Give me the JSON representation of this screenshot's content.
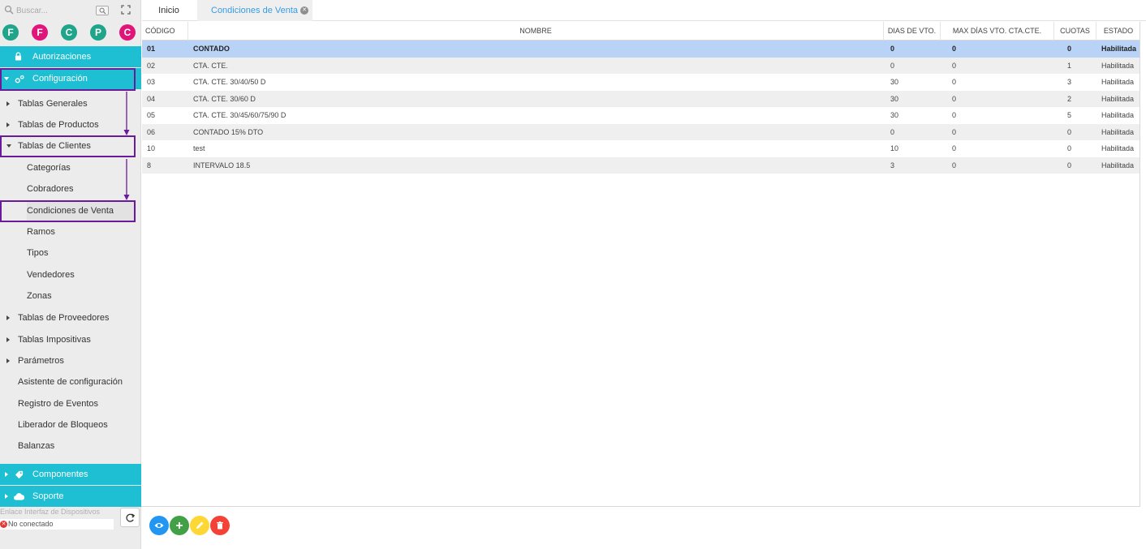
{
  "search": {
    "placeholder": "Buscar..."
  },
  "avatars": [
    {
      "letter": "F",
      "color": "#1fa58a"
    },
    {
      "letter": "F",
      "color": "#e0157a"
    },
    {
      "letter": "C",
      "color": "#1fa58a"
    },
    {
      "letter": "P",
      "color": "#1fa58a"
    },
    {
      "letter": "C",
      "color": "#e0157a"
    }
  ],
  "sidebar": {
    "autorizaciones": "Autorizaciones",
    "configuracion": "Configuración",
    "items": {
      "tablas_generales": "Tablas Generales",
      "tablas_productos": "Tablas de Productos",
      "tablas_clientes": "Tablas de Clientes",
      "categorias": "Categorías",
      "cobradores": "Cobradores",
      "condiciones": "Condiciones de Venta",
      "ramos": "Ramos",
      "tipos": "Tipos",
      "vendedores": "Vendedores",
      "zonas": "Zonas",
      "tablas_proveedores": "Tablas de Proveedores",
      "tablas_impositivas": "Tablas Impositivas",
      "parametros": "Parámetros",
      "asistente": "Asistente de configuración",
      "registro": "Registro de Eventos",
      "liberador": "Liberador de Bloqueos",
      "balanzas": "Balanzas"
    },
    "componentes": "Componentes",
    "soporte": "Soporte",
    "device_label": "Enlace Interfaz de Dispositivos",
    "device_status": "No conectado"
  },
  "tabs": {
    "home": "Inicio",
    "active": "Condiciones de Venta"
  },
  "table": {
    "headers": {
      "codigo": "CÓDIGO",
      "nombre": "NOMBRE",
      "dias": "DIAS DE VTO.",
      "max_dias": "MAX DÍAS VTO. CTA.CTE.",
      "cuotas": "CUOTAS",
      "estado": "ESTADO"
    },
    "rows": [
      {
        "codigo": "01",
        "nombre": "CONTADO",
        "dias": "0",
        "max_dias": "0",
        "cuotas": "0",
        "estado": "Habilitada"
      },
      {
        "codigo": "02",
        "nombre": "CTA. CTE.",
        "dias": "0",
        "max_dias": "0",
        "cuotas": "1",
        "estado": "Habilitada"
      },
      {
        "codigo": "03",
        "nombre": "CTA. CTE. 30/40/50 D",
        "dias": "30",
        "max_dias": "0",
        "cuotas": "3",
        "estado": "Habilitada"
      },
      {
        "codigo": "04",
        "nombre": "CTA. CTE. 30/60 D",
        "dias": "30",
        "max_dias": "0",
        "cuotas": "2",
        "estado": "Habilitada"
      },
      {
        "codigo": "05",
        "nombre": "CTA. CTE. 30/45/60/75/90 D",
        "dias": "30",
        "max_dias": "0",
        "cuotas": "5",
        "estado": "Habilitada"
      },
      {
        "codigo": "06",
        "nombre": "CONTADO 15% DTO",
        "dias": "0",
        "max_dias": "0",
        "cuotas": "0",
        "estado": "Habilitada"
      },
      {
        "codigo": "10",
        "nombre": "test",
        "dias": "10",
        "max_dias": "0",
        "cuotas": "0",
        "estado": "Habilitada"
      },
      {
        "codigo": "8",
        "nombre": "INTERVALO 18.5",
        "dias": "3",
        "max_dias": "0",
        "cuotas": "0",
        "estado": "Habilitada"
      }
    ]
  },
  "actions": {
    "view_color": "#2196f3",
    "add_color": "#43a047",
    "edit_color": "#fdd835",
    "delete_color": "#f44336"
  },
  "colors": {
    "accent": "#1ebfd2",
    "highlight_outline": "#6a1b9a",
    "selected_row": "#b9d3f7",
    "tab_active_text": "#3a9be0"
  }
}
